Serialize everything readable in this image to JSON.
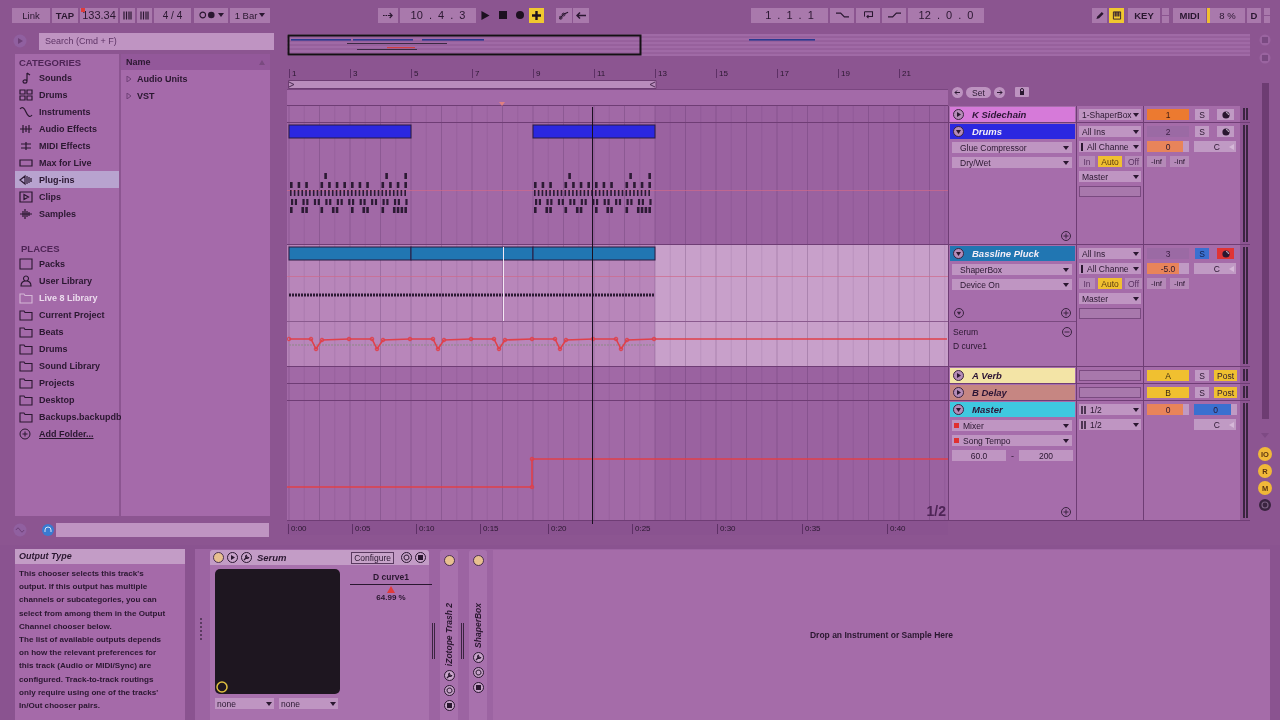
{
  "transport": {
    "link": "Link",
    "tap": "TAP",
    "tempo": "133.34",
    "signature": "4 / 4",
    "quantize": "1 Bar",
    "position": "10 . 4 . 3",
    "overdub": true,
    "loop_start": "1 . 1 . 1",
    "loop_length": "12 . 0 . 0",
    "computer_keyboard": true,
    "key": "KEY",
    "midi": "MIDI",
    "midi_activity": true,
    "cpu": "8 %",
    "disk": "D"
  },
  "browser": {
    "search": {
      "placeholder": "Search (Cmd + F)"
    },
    "categories_heading": "CATEGORIES",
    "categories": [
      {
        "label": "Sounds",
        "selected": false
      },
      {
        "label": "Drums",
        "selected": false
      },
      {
        "label": "Instruments",
        "selected": false
      },
      {
        "label": "Audio Effects",
        "selected": false
      },
      {
        "label": "MIDI Effects",
        "selected": false
      },
      {
        "label": "Max for Live",
        "selected": false
      },
      {
        "label": "Plug-ins",
        "selected": true
      },
      {
        "label": "Clips",
        "selected": false
      },
      {
        "label": "Samples",
        "selected": false
      }
    ],
    "places_heading": "PLACES",
    "places": [
      {
        "label": "Packs",
        "disabled": false
      },
      {
        "label": "User Library",
        "disabled": false
      },
      {
        "label": "Live 8 Library",
        "disabled": true
      },
      {
        "label": "Current Project",
        "disabled": false
      },
      {
        "label": "Beats",
        "disabled": false
      },
      {
        "label": "Drums",
        "disabled": false
      },
      {
        "label": "Sound Library",
        "disabled": false
      },
      {
        "label": "Projects",
        "disabled": false
      },
      {
        "label": "Desktop",
        "disabled": false
      },
      {
        "label": "Backups.backupdb",
        "disabled": false
      }
    ],
    "add_folder": "Add Folder...",
    "column": "Name",
    "items": [
      {
        "label": "Audio Units",
        "expanded": false
      },
      {
        "label": "VST",
        "expanded": false
      }
    ]
  },
  "arrangement": {
    "bars": [
      "1",
      "3",
      "5",
      "7",
      "9",
      "11",
      "13",
      "15",
      "17",
      "19",
      "21"
    ],
    "times": [
      "0:00",
      "0:05",
      "0:10",
      "0:15",
      "0:20",
      "0:25",
      "0:30",
      "0:35",
      "0:40"
    ],
    "set": "Set",
    "page": "1/2"
  },
  "tracks": [
    {
      "kind": "midi",
      "name": "K Sidechain",
      "color": "#d67ad9",
      "expanded": false,
      "selected": false,
      "output": "1-ShaperBox",
      "number": "1",
      "active": true,
      "solo_label": "S",
      "solo": false,
      "armed": false
    },
    {
      "kind": "midi",
      "name": "Drums",
      "color": "#2b27e0",
      "expanded": true,
      "selected": false,
      "device": "Glue Compressor",
      "parameter": "Dry/Wet",
      "automated": false,
      "input_type": "All Ins",
      "input_channel": "All Channe",
      "monitor": [
        {
          "label": "In",
          "selected": false
        },
        {
          "label": "Auto",
          "selected": true
        },
        {
          "label": "Off",
          "selected": false
        }
      ],
      "output": "Master",
      "number": "2",
      "active": false,
      "solo_label": "S",
      "solo": false,
      "armed": false,
      "volume": {
        "value": "0",
        "level": 0.85
      },
      "pan": "C",
      "peaks": [
        "-inf",
        "-inf"
      ]
    },
    {
      "kind": "midi",
      "name": "Bassline Pluck",
      "color": "#2176b2",
      "expanded": true,
      "selected": true,
      "device": "ShaperBox",
      "parameter": "Device On",
      "automated": false,
      "input_type": "All Ins",
      "input_channel": "All Channe",
      "monitor": [
        {
          "label": "In",
          "selected": false
        },
        {
          "label": "Auto",
          "selected": true
        },
        {
          "label": "Off",
          "selected": false
        }
      ],
      "output": "Master",
      "number": "3",
      "active": false,
      "solo_label": "S",
      "solo": true,
      "armed": true,
      "volume": {
        "value": "-5.0",
        "level": 0.75
      },
      "pan": "C",
      "peaks": [
        "-inf",
        "-inf"
      ],
      "lanes": [
        {
          "device": "Serum",
          "parameter": "D curve1"
        }
      ]
    },
    {
      "kind": "return",
      "name": "A Verb",
      "color": "#f3e4a6",
      "expanded": false,
      "selected": false,
      "number": "A",
      "active": true,
      "solo_label": "S",
      "solo": false,
      "post": "Post"
    },
    {
      "kind": "return",
      "name": "B Delay",
      "color": "#c68682",
      "expanded": false,
      "selected": false,
      "number": "B",
      "active": true,
      "solo_label": "S",
      "solo": false,
      "post": "Post"
    },
    {
      "kind": "master",
      "name": "Master",
      "color": "#3fc8e0",
      "expanded": true,
      "selected": false,
      "device": "Mixer",
      "parameter": "Song Tempo",
      "automated": true,
      "range": [
        "60.0",
        "-",
        "200"
      ],
      "outputs": [
        "1/2",
        "1/2"
      ],
      "volume": {
        "value": "0",
        "level": 0.85
      },
      "cue": {
        "value": "0",
        "level": 0.85
      },
      "pan": "C"
    }
  ],
  "side_buttons": [
    "IO",
    "R",
    "M"
  ],
  "info": {
    "title": "Output Type",
    "paragraphs": [
      "This chooser selects this track's output. If this output has multiple channels or subcategories, you can select from among them in the Output Channel chooser below.",
      "The list of available outputs depends on how the relevant preferences for this track (Audio or MIDI/Sync) are configured. Track-to-track routings only require using one of the tracks' In/Out chooser pairs."
    ]
  },
  "device": {
    "name": "Serum",
    "on": true,
    "configure": "Configure",
    "parameter": "D curve1",
    "automated": true,
    "level": 0.5,
    "value": "64.99 %",
    "x_choice": "none",
    "y_choice": "none"
  },
  "folded_devices": [
    {
      "name": "iZotope Trash 2",
      "on": true
    },
    {
      "name": "ShaperBox",
      "on": true
    }
  ],
  "drop_hint": "Drop an Instrument or Sample Here"
}
